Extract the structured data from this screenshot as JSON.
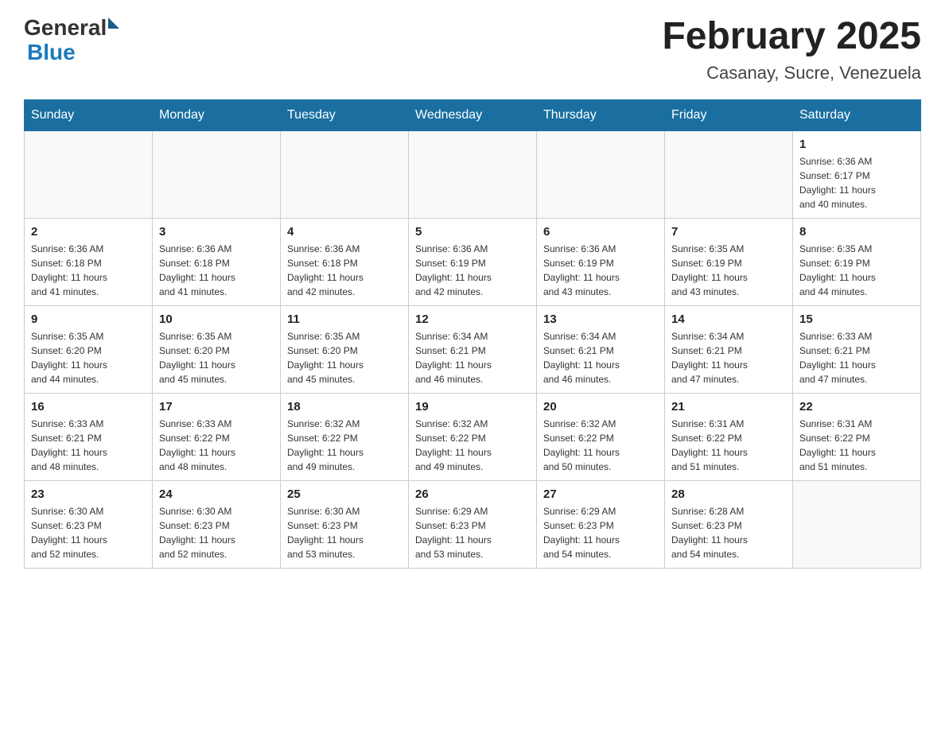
{
  "logo": {
    "general": "General",
    "blue": "Blue"
  },
  "title": "February 2025",
  "subtitle": "Casanay, Sucre, Venezuela",
  "days_of_week": [
    "Sunday",
    "Monday",
    "Tuesday",
    "Wednesday",
    "Thursday",
    "Friday",
    "Saturday"
  ],
  "weeks": [
    [
      {
        "day": "",
        "info": ""
      },
      {
        "day": "",
        "info": ""
      },
      {
        "day": "",
        "info": ""
      },
      {
        "day": "",
        "info": ""
      },
      {
        "day": "",
        "info": ""
      },
      {
        "day": "",
        "info": ""
      },
      {
        "day": "1",
        "info": "Sunrise: 6:36 AM\nSunset: 6:17 PM\nDaylight: 11 hours\nand 40 minutes."
      }
    ],
    [
      {
        "day": "2",
        "info": "Sunrise: 6:36 AM\nSunset: 6:18 PM\nDaylight: 11 hours\nand 41 minutes."
      },
      {
        "day": "3",
        "info": "Sunrise: 6:36 AM\nSunset: 6:18 PM\nDaylight: 11 hours\nand 41 minutes."
      },
      {
        "day": "4",
        "info": "Sunrise: 6:36 AM\nSunset: 6:18 PM\nDaylight: 11 hours\nand 42 minutes."
      },
      {
        "day": "5",
        "info": "Sunrise: 6:36 AM\nSunset: 6:19 PM\nDaylight: 11 hours\nand 42 minutes."
      },
      {
        "day": "6",
        "info": "Sunrise: 6:36 AM\nSunset: 6:19 PM\nDaylight: 11 hours\nand 43 minutes."
      },
      {
        "day": "7",
        "info": "Sunrise: 6:35 AM\nSunset: 6:19 PM\nDaylight: 11 hours\nand 43 minutes."
      },
      {
        "day": "8",
        "info": "Sunrise: 6:35 AM\nSunset: 6:19 PM\nDaylight: 11 hours\nand 44 minutes."
      }
    ],
    [
      {
        "day": "9",
        "info": "Sunrise: 6:35 AM\nSunset: 6:20 PM\nDaylight: 11 hours\nand 44 minutes."
      },
      {
        "day": "10",
        "info": "Sunrise: 6:35 AM\nSunset: 6:20 PM\nDaylight: 11 hours\nand 45 minutes."
      },
      {
        "day": "11",
        "info": "Sunrise: 6:35 AM\nSunset: 6:20 PM\nDaylight: 11 hours\nand 45 minutes."
      },
      {
        "day": "12",
        "info": "Sunrise: 6:34 AM\nSunset: 6:21 PM\nDaylight: 11 hours\nand 46 minutes."
      },
      {
        "day": "13",
        "info": "Sunrise: 6:34 AM\nSunset: 6:21 PM\nDaylight: 11 hours\nand 46 minutes."
      },
      {
        "day": "14",
        "info": "Sunrise: 6:34 AM\nSunset: 6:21 PM\nDaylight: 11 hours\nand 47 minutes."
      },
      {
        "day": "15",
        "info": "Sunrise: 6:33 AM\nSunset: 6:21 PM\nDaylight: 11 hours\nand 47 minutes."
      }
    ],
    [
      {
        "day": "16",
        "info": "Sunrise: 6:33 AM\nSunset: 6:21 PM\nDaylight: 11 hours\nand 48 minutes."
      },
      {
        "day": "17",
        "info": "Sunrise: 6:33 AM\nSunset: 6:22 PM\nDaylight: 11 hours\nand 48 minutes."
      },
      {
        "day": "18",
        "info": "Sunrise: 6:32 AM\nSunset: 6:22 PM\nDaylight: 11 hours\nand 49 minutes."
      },
      {
        "day": "19",
        "info": "Sunrise: 6:32 AM\nSunset: 6:22 PM\nDaylight: 11 hours\nand 49 minutes."
      },
      {
        "day": "20",
        "info": "Sunrise: 6:32 AM\nSunset: 6:22 PM\nDaylight: 11 hours\nand 50 minutes."
      },
      {
        "day": "21",
        "info": "Sunrise: 6:31 AM\nSunset: 6:22 PM\nDaylight: 11 hours\nand 51 minutes."
      },
      {
        "day": "22",
        "info": "Sunrise: 6:31 AM\nSunset: 6:22 PM\nDaylight: 11 hours\nand 51 minutes."
      }
    ],
    [
      {
        "day": "23",
        "info": "Sunrise: 6:30 AM\nSunset: 6:23 PM\nDaylight: 11 hours\nand 52 minutes."
      },
      {
        "day": "24",
        "info": "Sunrise: 6:30 AM\nSunset: 6:23 PM\nDaylight: 11 hours\nand 52 minutes."
      },
      {
        "day": "25",
        "info": "Sunrise: 6:30 AM\nSunset: 6:23 PM\nDaylight: 11 hours\nand 53 minutes."
      },
      {
        "day": "26",
        "info": "Sunrise: 6:29 AM\nSunset: 6:23 PM\nDaylight: 11 hours\nand 53 minutes."
      },
      {
        "day": "27",
        "info": "Sunrise: 6:29 AM\nSunset: 6:23 PM\nDaylight: 11 hours\nand 54 minutes."
      },
      {
        "day": "28",
        "info": "Sunrise: 6:28 AM\nSunset: 6:23 PM\nDaylight: 11 hours\nand 54 minutes."
      },
      {
        "day": "",
        "info": ""
      }
    ]
  ]
}
